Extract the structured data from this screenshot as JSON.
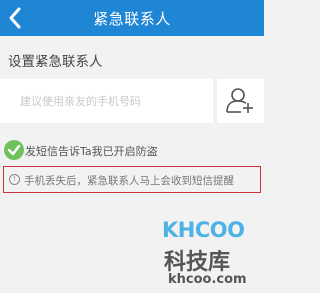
{
  "header": {
    "title": "紧急联系人",
    "back_icon": "chevron-left-icon",
    "background": "#1f86d6"
  },
  "section": {
    "title": "设置紧急联系人"
  },
  "phone_field": {
    "placeholder": "建议使用亲友的手机号码",
    "value": "",
    "contact_icon": "add-contact-icon"
  },
  "sms_option": {
    "label": "发短信告诉Ta我已开启防盗",
    "checked": true,
    "check_color": "#6fc15c"
  },
  "notice": {
    "icon": "info-icon",
    "text": "手机丢失后，紧急联系人马上会收到短信提醒",
    "border_color": "#c9353a"
  },
  "watermark": {
    "logo": "KHCOO",
    "name": "科技库",
    "url": "khcoo.com"
  }
}
